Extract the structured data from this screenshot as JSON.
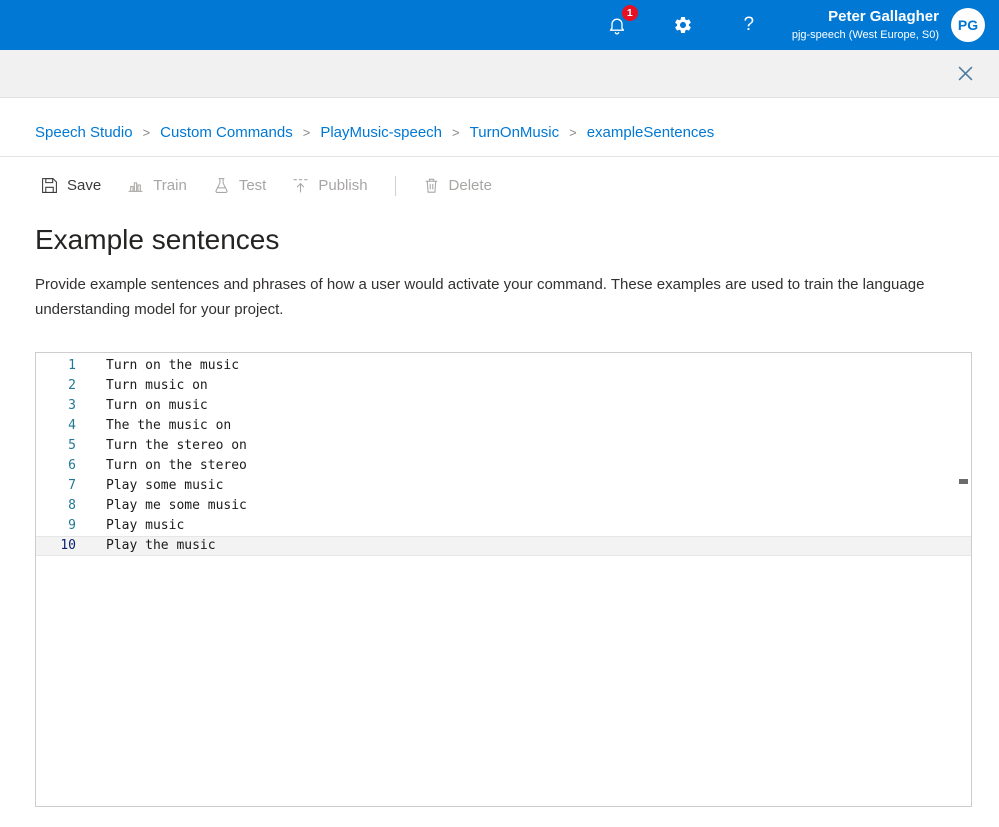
{
  "colors": {
    "accent": "#0078d4",
    "badge": "#e81123"
  },
  "icons": {
    "notifications": "bell",
    "settings": "gear",
    "help": "?",
    "close": "x",
    "save": "floppy-disk",
    "train": "bar-building",
    "test": "flask",
    "publish": "upload",
    "delete": "trash"
  },
  "header": {
    "notification_count": "1",
    "help_glyph": "?",
    "user": {
      "name": "Peter Gallagher",
      "subtitle": "pjg-speech (West Europe, S0)",
      "initials": "PG"
    }
  },
  "breadcrumb": {
    "separator": ">",
    "items": [
      "Speech Studio",
      "Custom Commands",
      "PlayMusic-speech",
      "TurnOnMusic",
      "exampleSentences"
    ]
  },
  "toolbar": {
    "save": "Save",
    "train": "Train",
    "test": "Test",
    "publish": "Publish",
    "delete": "Delete"
  },
  "page": {
    "title": "Example sentences",
    "description": "Provide example sentences and phrases of how a user would activate your command. These examples are used to train the language understanding model for your project."
  },
  "editor": {
    "active_line": 10,
    "lines": [
      "Turn on the music",
      "Turn music on",
      "Turn on music",
      "The the music on",
      "Turn the stereo on",
      "Turn on the stereo",
      "Play some music",
      "Play me some music",
      "Play music",
      "Play the music"
    ]
  }
}
